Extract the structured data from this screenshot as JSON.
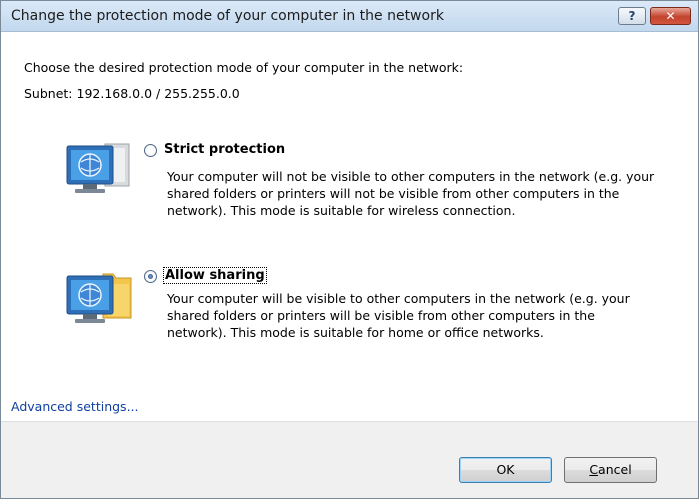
{
  "window": {
    "title": "Change the protection mode of your computer in the network",
    "help_label": "?",
    "close_label": "✕"
  },
  "intro_text": "Choose the desired protection mode of your computer in the network:",
  "subnet_text": "Subnet: 192.168.0.0 / 255.255.0.0",
  "options": [
    {
      "label": "Strict protection",
      "selected": false,
      "icon": "computer-monitor-icon",
      "description": "Your computer will not be visible to other computers in the network (e.g. your shared folders or printers will not be visible from other computers in the network). This mode is suitable for wireless connection."
    },
    {
      "label": "Allow sharing",
      "selected": true,
      "icon": "computer-shared-folder-icon",
      "description": "Your computer will be visible to other computers in the network (e.g. your shared folders or printers will be visible from other computers in the network). This mode is suitable for home or office networks."
    }
  ],
  "advanced_link": "Advanced settings...",
  "buttons": {
    "ok": "OK",
    "cancel_first": "C",
    "cancel_rest": "ancel"
  },
  "colors": {
    "link": "#0f3f9e",
    "titlebar": "#c2d8ee",
    "footer": "#f0f0f0"
  }
}
